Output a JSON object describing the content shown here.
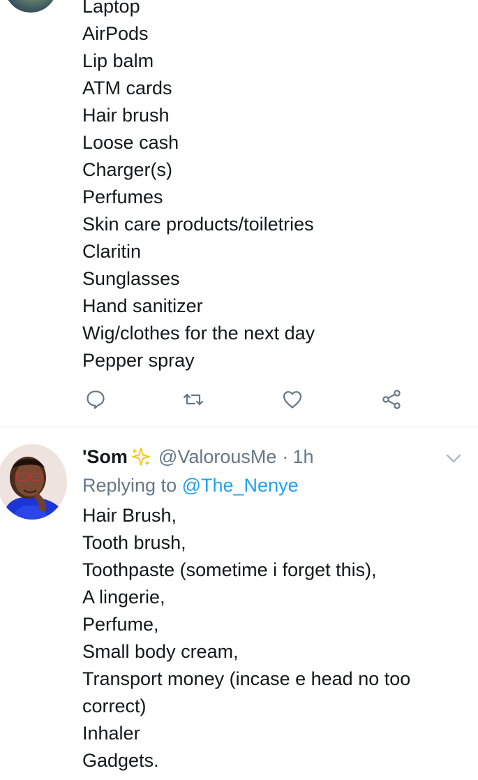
{
  "top_tweet": {
    "items": [
      "Laptop",
      "AirPods",
      "Lip balm",
      "ATM cards",
      "Hair brush",
      "Loose cash",
      "Charger(s)",
      "Perfumes",
      "Skin care products/toiletries",
      "Claritin",
      "Sunglasses",
      "Hand sanitizer",
      "Wig/clothes for the next day",
      "Pepper spray"
    ],
    "actions": {
      "reply_icon": "speech-bubble-icon",
      "retweet_icon": "retweet-icon",
      "like_icon": "heart-icon",
      "share_icon": "share-icon"
    }
  },
  "reply_tweet": {
    "display_name": "'Som",
    "name_emoji": "sparkles-icon",
    "handle": "@ValorousMe",
    "separator": "·",
    "time": "1h",
    "replying_prefix": "Replying to",
    "replying_to": "@The_Nenye",
    "items": [
      "Hair Brush,",
      "Tooth brush,",
      "Toothpaste (sometime i forget this),",
      "A lingerie,",
      "Perfume,",
      "Small body cream,",
      "Transport money (incase e head no too",
      "correct)",
      "Inhaler",
      "Gadgets."
    ]
  },
  "colors": {
    "text": "#14171a",
    "secondary": "#657786",
    "link": "#1da1f2",
    "divider": "#e1e8ed",
    "icon": "#657786"
  }
}
